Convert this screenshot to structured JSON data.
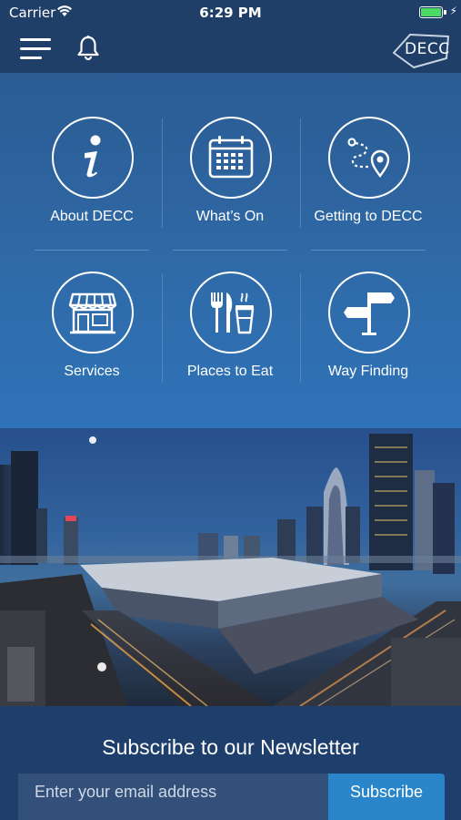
{
  "status": {
    "carrier": "Carrier",
    "time": "6:29 PM",
    "battery_level": 1.0
  },
  "header": {
    "logo_text": "DECC",
    "icons": [
      "menu-icon",
      "bell-icon"
    ]
  },
  "tiles": [
    {
      "label": "About DECC",
      "icon": "info-icon"
    },
    {
      "label": "What’s On",
      "icon": "calendar-icon"
    },
    {
      "label": "Getting to DECC",
      "icon": "route-pin-icon"
    },
    {
      "label": "Services",
      "icon": "storefront-icon"
    },
    {
      "label": "Places to Eat",
      "icon": "fork-knife-cup-icon"
    },
    {
      "label": "Way Finding",
      "icon": "signpost-icon"
    }
  ],
  "hero": {
    "image": "doha-convention-center-night-skyline"
  },
  "newsletter": {
    "title": "Subscribe to our Newsletter",
    "email_placeholder": "Enter your email address",
    "button_label": "Subscribe"
  },
  "colors": {
    "nav_background": "#1f3e68",
    "grid_top": "#2b5b92",
    "grid_bottom": "#2f73b8",
    "subscribe_button": "#2a86c8",
    "battery": "#4cd964"
  }
}
